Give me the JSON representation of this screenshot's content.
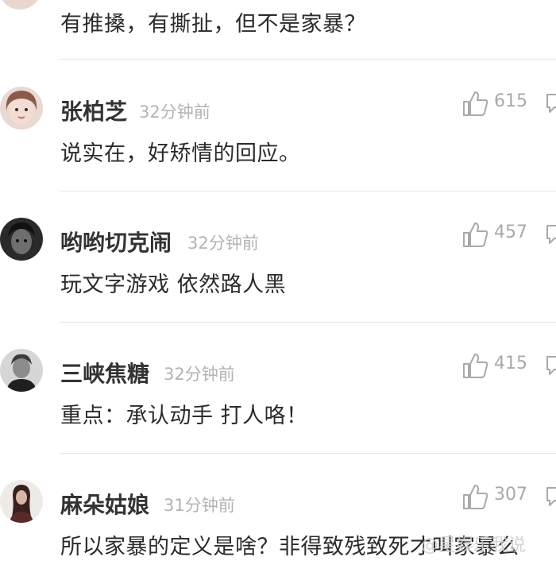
{
  "top_comment": {
    "text": "有推搡，有撕扯，但不是家暴？"
  },
  "comments": [
    {
      "username": "张柏芝",
      "time": "32分钟前",
      "text": "说实在，好矫情的回应。",
      "likes": "615"
    },
    {
      "username": "哟哟切克闹",
      "time": "32分钟前",
      "text": "玩文字游戏 依然路人黑",
      "likes": "457"
    },
    {
      "username": "三峡焦糖",
      "time": "32分钟前",
      "text": "重点：承认动手 打人咯！",
      "likes": "415"
    },
    {
      "username": "麻朵姑娘",
      "time": "31分钟前",
      "text": "所以家暴的定义是啥？非得致残致死才叫家暴么",
      "likes": "307"
    }
  ],
  "watermark": "@星娱乐我说",
  "colors": {
    "text": "#2b2b2b",
    "username": "#333333",
    "meta": "#b3b3b3",
    "divider": "#e6e6e6"
  },
  "icons": {
    "like": "thumbs-up-icon",
    "reply": "comment-bubble-icon"
  }
}
